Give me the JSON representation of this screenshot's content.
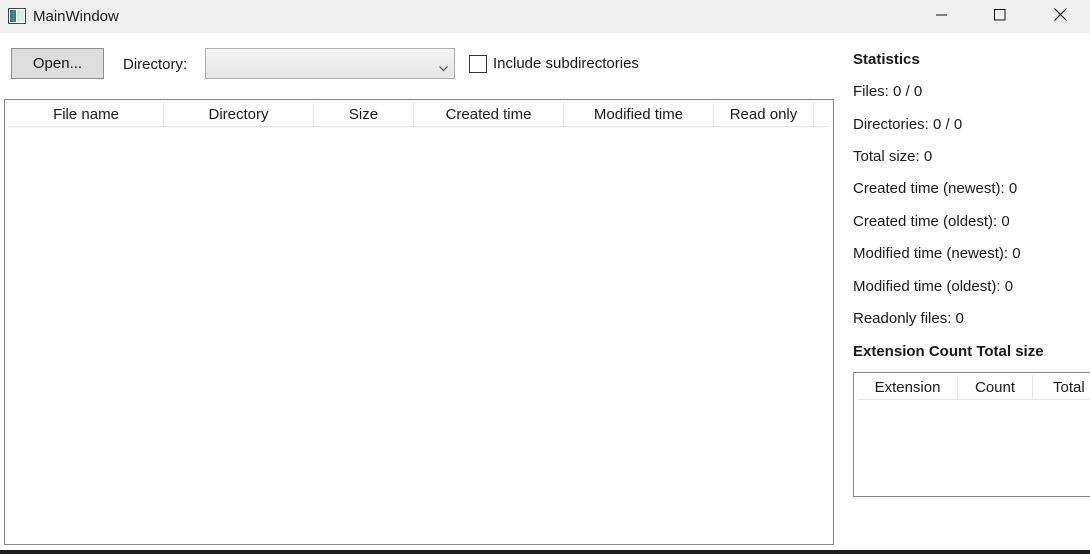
{
  "window": {
    "title": "MainWindow"
  },
  "toolbar": {
    "open_label": "Open...",
    "directory_label": "Directory:",
    "directory_value": "",
    "include_subdirectories_label": "Include subdirectories",
    "include_subdirectories_checked": false
  },
  "files_table": {
    "columns": [
      "File name",
      "Directory",
      "Size",
      "Created time",
      "Modified time",
      "Read only"
    ],
    "rows": []
  },
  "statistics": {
    "title": "Statistics",
    "files": "Files: 0 / 0",
    "directories": "Directories: 0 / 0",
    "total_size": "Total size: 0",
    "created_newest": "Created time (newest): 0",
    "created_oldest": "Created time (oldest): 0",
    "modified_newest": "Modified time (newest): 0",
    "modified_oldest": "Modified time (oldest): 0",
    "readonly_files": "Readonly files: 0",
    "extension_title": "Extension Count  Total size"
  },
  "extension_table": {
    "columns": [
      "Extension",
      "Count",
      "Total"
    ],
    "rows": []
  },
  "icons": {
    "app": "app-window-icon",
    "minimize": "minimize-icon",
    "maximize": "maximize-icon",
    "close": "close-icon",
    "dropdown": "chevron-down-icon"
  }
}
